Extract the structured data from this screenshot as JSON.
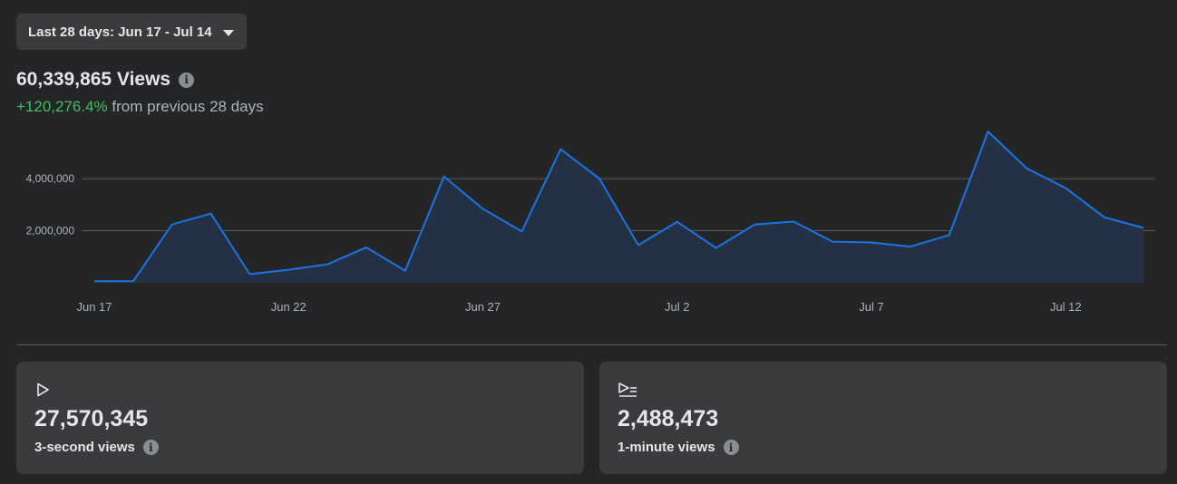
{
  "date_range": {
    "label": "Last 28 days: Jun 17 - Jul 14"
  },
  "summary": {
    "views": "60,339,865 Views",
    "change": "+120,276.4%",
    "change_suffix": " from previous 28 days"
  },
  "chart_data": {
    "type": "area",
    "x": [
      "Jun 17",
      "Jun 18",
      "Jun 19",
      "Jun 20",
      "Jun 21",
      "Jun 22",
      "Jun 23",
      "Jun 24",
      "Jun 25",
      "Jun 26",
      "Jun 27",
      "Jun 28",
      "Jun 29",
      "Jun 30",
      "Jul 1",
      "Jul 2",
      "Jul 3",
      "Jul 4",
      "Jul 5",
      "Jul 6",
      "Jul 7",
      "Jul 8",
      "Jul 9",
      "Jul 10",
      "Jul 11",
      "Jul 12",
      "Jul 13",
      "Jul 14"
    ],
    "x_tick_labels": [
      "Jun 17",
      "Jun 22",
      "Jun 27",
      "Jul 2",
      "Jul 7",
      "Jul 12"
    ],
    "y_ticks": [
      2000000,
      4000000
    ],
    "y_tick_labels": [
      "2,000,000",
      "4,000,000"
    ],
    "ylim": [
      0,
      5500000
    ],
    "series": [
      {
        "values": [
          60000,
          60000,
          2240000,
          2660000,
          330000,
          500000,
          710000,
          1360000,
          460000,
          4080000,
          2840000,
          1970000,
          5130000,
          4000000,
          1450000,
          2340000,
          1340000,
          2240000,
          2350000,
          1580000,
          1550000,
          1390000,
          1830000,
          5810000,
          4390000,
          3640000,
          2510000,
          2110000
        ]
      }
    ],
    "colors": {
      "line": "#1b74e4",
      "fill": "#243144",
      "grid": "#5a5b5d"
    }
  },
  "metrics": [
    {
      "icon": "play-icon",
      "value": "27,570,345",
      "label": "3-second views"
    },
    {
      "icon": "play-list-icon",
      "value": "2,488,473",
      "label": "1-minute views"
    }
  ],
  "icons": {
    "info": "i"
  }
}
